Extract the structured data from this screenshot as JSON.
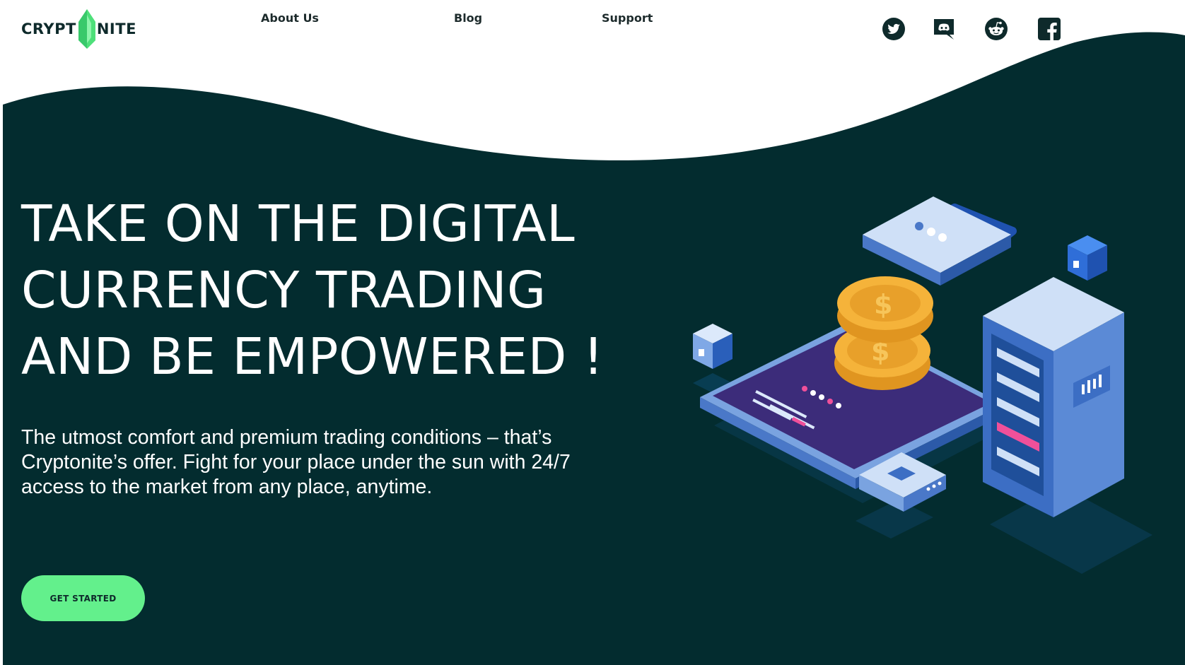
{
  "brand": {
    "logo_left": "CRYPT",
    "logo_right": "NITE",
    "gem_color": "#4ee07a"
  },
  "nav": {
    "items": [
      {
        "label": "About Us"
      },
      {
        "label": "Blog"
      },
      {
        "label": "Support"
      }
    ]
  },
  "social": [
    {
      "icon": "twitter-icon"
    },
    {
      "icon": "discord-icon"
    },
    {
      "icon": "reddit-icon"
    },
    {
      "icon": "facebook-icon"
    }
  ],
  "hero": {
    "headline_lines": [
      "TAKE ON THE DIGITAL",
      "CURRENCY TRADING",
      "AND BE EMPOWERED !"
    ],
    "subtitle": "The utmost comfort and premium trading conditions – that’s Cryptonite’s offer. Fight for your place under the sun with 24/7 access to the market from any place, anytime.",
    "cta_label": "GET STARTED"
  },
  "colors": {
    "background_dark": "#032c2f",
    "accent_green": "#63f08c",
    "text_dark": "#0e2a2b",
    "illustration_blue": "#2f64b8",
    "coin_gold": "#f5b33a"
  }
}
